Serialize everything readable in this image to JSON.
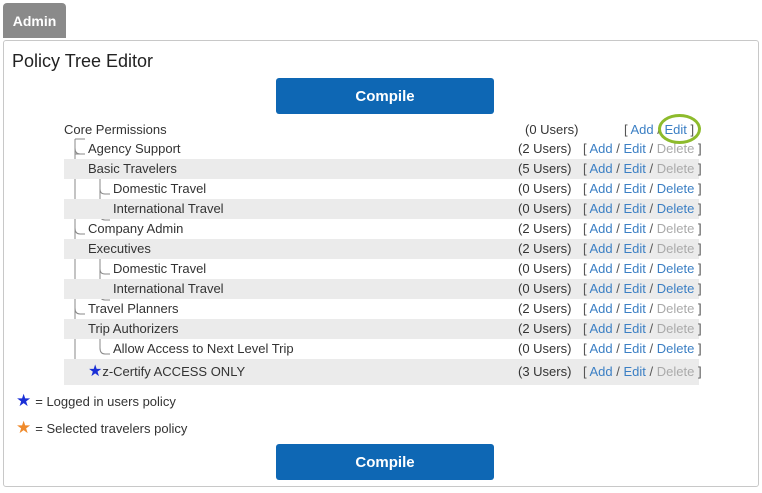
{
  "tab": {
    "label": "Admin"
  },
  "panel": {
    "title": "Policy Tree Editor"
  },
  "compile_label": "Compile",
  "tree": [
    {
      "name": "Core Permissions",
      "users": "(0 Users)",
      "add": "Add",
      "edit": "Edit",
      "delete": "",
      "delete_enabled": false
    },
    {
      "name": "Agency Support",
      "users": "(2 Users)",
      "add": "Add",
      "edit": "Edit",
      "delete": "Delete",
      "delete_enabled": false
    },
    {
      "name": "Basic Travelers",
      "users": "(5 Users)",
      "add": "Add",
      "edit": "Edit",
      "delete": "Delete",
      "delete_enabled": false
    },
    {
      "name": "Domestic Travel",
      "users": "(0 Users)",
      "add": "Add",
      "edit": "Edit",
      "delete": "Delete",
      "delete_enabled": true
    },
    {
      "name": "International Travel",
      "users": "(0 Users)",
      "add": "Add",
      "edit": "Edit",
      "delete": "Delete",
      "delete_enabled": true
    },
    {
      "name": "Company Admin",
      "users": "(2 Users)",
      "add": "Add",
      "edit": "Edit",
      "delete": "Delete",
      "delete_enabled": false
    },
    {
      "name": "Executives",
      "users": "(2 Users)",
      "add": "Add",
      "edit": "Edit",
      "delete": "Delete",
      "delete_enabled": false
    },
    {
      "name": "Domestic Travel",
      "users": "(0 Users)",
      "add": "Add",
      "edit": "Edit",
      "delete": "Delete",
      "delete_enabled": true
    },
    {
      "name": "International Travel",
      "users": "(0 Users)",
      "add": "Add",
      "edit": "Edit",
      "delete": "Delete",
      "delete_enabled": true
    },
    {
      "name": "Travel Planners",
      "users": "(2 Users)",
      "add": "Add",
      "edit": "Edit",
      "delete": "Delete",
      "delete_enabled": false
    },
    {
      "name": "Trip Authorizers",
      "users": "(2 Users)",
      "add": "Add",
      "edit": "Edit",
      "delete": "Delete",
      "delete_enabled": false
    },
    {
      "name": "Allow Access to Next Level Trip",
      "users": "(0 Users)",
      "add": "Add",
      "edit": "Edit",
      "delete": "Delete",
      "delete_enabled": true
    },
    {
      "name": "z-Certify ACCESS ONLY",
      "users": "(3 Users)",
      "add": "Add",
      "edit": "Edit",
      "delete": "Delete",
      "delete_enabled": false
    }
  ],
  "legend": {
    "logged_in": "= Logged in users policy",
    "selected": "= Selected travelers policy"
  },
  "colors": {
    "compile_button": "#0e67b4",
    "link": "#3b7fc4",
    "disabled_link": "#aaaaaa",
    "highlight_circle": "#8dbb2c",
    "logged_in_star": "#1a2fd6",
    "selected_star": "#ef8a2b"
  }
}
